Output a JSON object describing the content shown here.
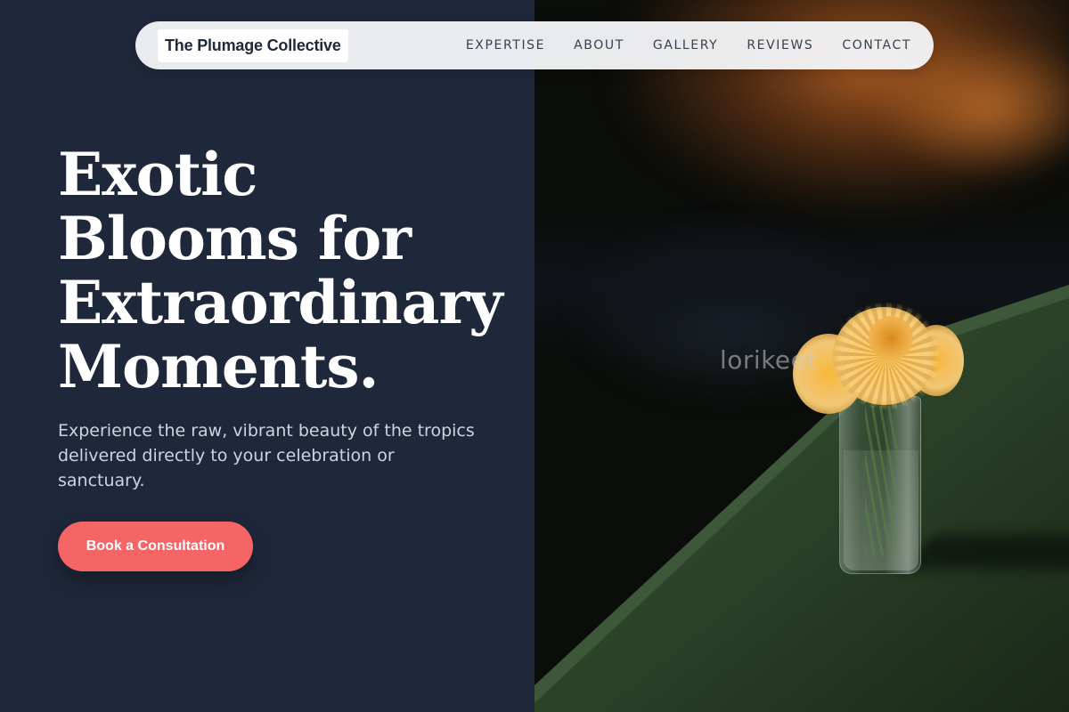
{
  "header": {
    "brand": "The Plumage Collective",
    "nav": [
      {
        "label": "EXPERTISE"
      },
      {
        "label": "ABOUT"
      },
      {
        "label": "GALLERY"
      },
      {
        "label": "REVIEWS"
      },
      {
        "label": "CONTACT"
      }
    ]
  },
  "hero": {
    "title_lines": [
      "Exotic",
      "Blooms for",
      "Extraordinary",
      "Moments."
    ],
    "subtitle": "Experience the raw, vibrant beauty of the tropics delivered directly to your celebration or sanctuary.",
    "cta_label": "Book a Consultation"
  },
  "image": {
    "watermark": "lorikeet",
    "subject": "yellow-chrysanthemum-in-glass-vase"
  },
  "colors": {
    "left_panel_bg": "#1f283b",
    "accent": "#f56565",
    "nav_bg": "#f3f4f6",
    "title_text": "#ffffff",
    "subtitle_text": "#cbd5e1"
  }
}
